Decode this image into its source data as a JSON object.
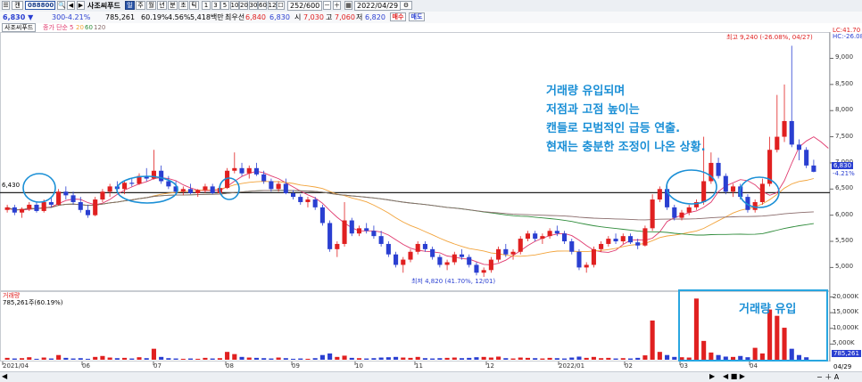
{
  "toolbar": {
    "mode_label": "캔",
    "stock_code": "088800",
    "stock_name": "사조씨푸드",
    "period_buttons": [
      "일",
      "주",
      "월",
      "년",
      "분",
      "초",
      "틱"
    ],
    "interval_buttons": [
      "1",
      "3",
      "5",
      "10",
      "20",
      "30",
      "60",
      "120"
    ],
    "count": "252",
    "count_total": "600",
    "date": "2022/04/29",
    "buy_label": "매수",
    "sell_label": "매도"
  },
  "quote": {
    "price": "6,830 ▼",
    "change": "300",
    "change_pct": "-4.21%",
    "volume": "785,261",
    "vol_ratio": "60.19%",
    "turnover_ratio": "4.56%",
    "amount": "5,418백만",
    "priority_label": "최우선",
    "bid1": "6,840",
    "ask1": "6,830",
    "open_label": "시",
    "open": "7,030",
    "high_label": "고",
    "high": "7,060",
    "low_label": "저",
    "low": "6,820"
  },
  "legend": {
    "name": "사조씨푸드",
    "ma_label": "종가 단순",
    "ma_periods": [
      "5",
      "20",
      "60",
      "120"
    ],
    "ma_colors": [
      "#e0396e",
      "#f2a33a",
      "#2e8b3a",
      "#8a6b6b"
    ]
  },
  "price_pane": {
    "ref_line_label": "6,430",
    "ref_value": 6430,
    "lc_label": "LC:41.70",
    "hc_label": "HC:-26.08",
    "last_label": "6,830",
    "last_pct": "-4.21%",
    "high_note": "최고 9,240 (-26.08%, 04/27)",
    "low_note": "최저 4,820 (41.70%, 12/01)",
    "annotation_lines": [
      "거래량 유입되며",
      "저점과 고점 높이는",
      "캔들로 모범적인 급등 연출.",
      "현재는 충분한 조정이 나온 상황."
    ]
  },
  "volume_pane": {
    "title": "거래량",
    "value_label": "785,261주(60.19%)",
    "last_label": "785,261",
    "last_date_label": "04/29",
    "annotation": "거래량 유입"
  },
  "axis": {
    "price_ticks": [
      "9,000",
      "8,500",
      "8,000",
      "7,500",
      "7,000",
      "6,500",
      "6,000",
      "5,500",
      "5,000"
    ],
    "volume_ticks": [
      "20,000K",
      "15,000K",
      "10,000K",
      "5,000K"
    ],
    "date_labels": [
      "2021/04",
      "06",
      "07",
      "08",
      "09",
      "10",
      "11",
      "12",
      "2022/01",
      "02",
      "03",
      "04"
    ]
  },
  "colors": {
    "up": "#e02020",
    "down": "#2a3fd1",
    "accent": "#1a8fd6"
  },
  "chart_data": {
    "type": "candlestick",
    "price_range": [
      4700,
      9400
    ],
    "volume_range": [
      0,
      21000
    ],
    "volume_unit": "K",
    "dates": [
      "2021/04",
      "06",
      "07",
      "08",
      "09",
      "10",
      "11",
      "12",
      "2022/01",
      "02",
      "03",
      "04"
    ],
    "candles": [
      [
        6100,
        6200,
        6050,
        6150
      ],
      [
        6150,
        6200,
        6000,
        6050
      ],
      [
        6050,
        6150,
        5950,
        6120
      ],
      [
        6120,
        6250,
        6080,
        6200
      ],
      [
        6200,
        6250,
        6050,
        6080
      ],
      [
        6080,
        6300,
        6050,
        6250
      ],
      [
        6250,
        6350,
        6150,
        6200
      ],
      [
        6200,
        6500,
        6180,
        6450
      ],
      [
        6450,
        6550,
        6300,
        6380
      ],
      [
        6380,
        6450,
        6200,
        6250
      ],
      [
        6250,
        6350,
        6050,
        6100
      ],
      [
        6100,
        6200,
        5950,
        6000
      ],
      [
        6000,
        6350,
        5980,
        6300
      ],
      [
        6300,
        6500,
        6250,
        6450
      ],
      [
        6450,
        6600,
        6350,
        6550
      ],
      [
        6550,
        6650,
        6450,
        6500
      ],
      [
        6500,
        6650,
        6400,
        6620
      ],
      [
        6620,
        6700,
        6550,
        6600
      ],
      [
        6600,
        6800,
        6580,
        6750
      ],
      [
        6750,
        6900,
        6650,
        6700
      ],
      [
        6700,
        7250,
        6680,
        6850
      ],
      [
        6850,
        6950,
        6600,
        6650
      ],
      [
        6650,
        6750,
        6500,
        6550
      ],
      [
        6550,
        6650,
        6400,
        6450
      ],
      [
        6450,
        6550,
        6380,
        6500
      ],
      [
        6500,
        6600,
        6400,
        6420
      ],
      [
        6420,
        6500,
        6350,
        6480
      ],
      [
        6480,
        6600,
        6420,
        6550
      ],
      [
        6550,
        6600,
        6400,
        6420
      ],
      [
        6420,
        6550,
        6400,
        6520
      ],
      [
        6520,
        6900,
        6500,
        6850
      ],
      [
        6850,
        7200,
        6800,
        6900
      ],
      [
        6900,
        7000,
        6750,
        6800
      ],
      [
        6800,
        6950,
        6700,
        6900
      ],
      [
        6900,
        7000,
        6750,
        6780
      ],
      [
        6780,
        6850,
        6600,
        6650
      ],
      [
        6650,
        6700,
        6450,
        6500
      ],
      [
        6500,
        6650,
        6450,
        6600
      ],
      [
        6600,
        6700,
        6400,
        6420
      ],
      [
        6420,
        6480,
        6300,
        6350
      ],
      [
        6350,
        6400,
        6200,
        6250
      ],
      [
        6250,
        6350,
        6150,
        6300
      ],
      [
        6300,
        6350,
        6100,
        6150
      ],
      [
        6150,
        6200,
        5800,
        5850
      ],
      [
        5850,
        5900,
        5300,
        5350
      ],
      [
        5350,
        5500,
        5200,
        5450
      ],
      [
        5450,
        6250,
        5400,
        5900
      ],
      [
        5900,
        5950,
        5600,
        5650
      ],
      [
        5650,
        5800,
        5600,
        5750
      ],
      [
        5750,
        5850,
        5650,
        5700
      ],
      [
        5700,
        5800,
        5550,
        5600
      ],
      [
        5600,
        5700,
        5400,
        5450
      ],
      [
        5450,
        5500,
        5200,
        5250
      ],
      [
        5250,
        5300,
        5000,
        5050
      ],
      [
        5050,
        5200,
        4900,
        5150
      ],
      [
        5150,
        5350,
        5100,
        5300
      ],
      [
        5300,
        5500,
        5250,
        5450
      ],
      [
        5450,
        5500,
        5300,
        5350
      ],
      [
        5350,
        5400,
        5150,
        5200
      ],
      [
        5200,
        5250,
        5000,
        5050
      ],
      [
        5050,
        5150,
        4950,
        5100
      ],
      [
        5100,
        5300,
        5050,
        5250
      ],
      [
        5250,
        5350,
        5150,
        5200
      ],
      [
        5200,
        5250,
        5000,
        5050
      ],
      [
        5050,
        5100,
        4850,
        4900
      ],
      [
        4900,
        5000,
        4820,
        4950
      ],
      [
        4950,
        5200,
        4900,
        5150
      ],
      [
        5150,
        5400,
        5100,
        5350
      ],
      [
        5350,
        5450,
        5200,
        5250
      ],
      [
        5250,
        5350,
        5150,
        5300
      ],
      [
        5300,
        5600,
        5250,
        5550
      ],
      [
        5550,
        5700,
        5500,
        5650
      ],
      [
        5650,
        5700,
        5500,
        5550
      ],
      [
        5550,
        5650,
        5450,
        5600
      ],
      [
        5600,
        5750,
        5550,
        5700
      ],
      [
        5700,
        5800,
        5600,
        5650
      ],
      [
        5650,
        5700,
        5450,
        5500
      ],
      [
        5500,
        5550,
        5250,
        5300
      ],
      [
        5300,
        5350,
        4950,
        5000
      ],
      [
        5000,
        5100,
        4900,
        5050
      ],
      [
        5050,
        5400,
        5000,
        5350
      ],
      [
        5350,
        5500,
        5300,
        5450
      ],
      [
        5450,
        5600,
        5400,
        5550
      ],
      [
        5550,
        5650,
        5450,
        5500
      ],
      [
        5500,
        5650,
        5450,
        5600
      ],
      [
        5600,
        5650,
        5450,
        5480
      ],
      [
        5480,
        5550,
        5350,
        5420
      ],
      [
        5420,
        5800,
        5400,
        5750
      ],
      [
        5750,
        6400,
        5700,
        6300
      ],
      [
        6300,
        6550,
        6250,
        6500
      ],
      [
        6500,
        6600,
        6100,
        6150
      ],
      [
        6150,
        6200,
        5900,
        5950
      ],
      [
        5950,
        6100,
        5900,
        6050
      ],
      [
        6050,
        6200,
        6000,
        6150
      ],
      [
        6150,
        6300,
        6100,
        6250
      ],
      [
        6250,
        7500,
        6200,
        6650
      ],
      [
        6650,
        7200,
        6600,
        7000
      ],
      [
        7000,
        7100,
        6700,
        6750
      ],
      [
        6750,
        6800,
        6400,
        6450
      ],
      [
        6450,
        6600,
        6350,
        6550
      ],
      [
        6550,
        6600,
        6300,
        6350
      ],
      [
        6350,
        6400,
        6050,
        6100
      ],
      [
        6100,
        6300,
        6050,
        6250
      ],
      [
        6250,
        6700,
        6200,
        6600
      ],
      [
        6600,
        7500,
        6550,
        7250
      ],
      [
        7250,
        8300,
        7200,
        7500
      ],
      [
        7500,
        8500,
        7400,
        7800
      ],
      [
        7800,
        9240,
        7300,
        7350
      ],
      [
        7350,
        7450,
        7050,
        7250
      ],
      [
        7250,
        7300,
        6900,
        6950
      ],
      [
        6950,
        7060,
        6820,
        6830
      ]
    ],
    "volumes": [
      600,
      400,
      500,
      800,
      300,
      700,
      400,
      1500,
      600,
      400,
      500,
      300,
      900,
      1200,
      700,
      500,
      600,
      400,
      800,
      500,
      3500,
      900,
      500,
      400,
      300,
      400,
      300,
      600,
      400,
      500,
      2500,
      1800,
      900,
      700,
      600,
      500,
      400,
      700,
      500,
      300,
      400,
      300,
      500,
      1500,
      2000,
      900,
      1300,
      600,
      500,
      400,
      500,
      700,
      800,
      900,
      700,
      600,
      900,
      500,
      400,
      500,
      600,
      700,
      500,
      600,
      800,
      900,
      700,
      1000,
      500,
      400,
      700,
      600,
      500,
      400,
      600,
      500,
      400,
      700,
      1000,
      600,
      900,
      500,
      600,
      400,
      500,
      400,
      600,
      1400,
      12500,
      2500,
      1500,
      900,
      800,
      700,
      19500,
      6000,
      2300,
      1500,
      1000,
      900,
      1200,
      800,
      3800,
      2000,
      16000,
      14000,
      10200,
      3500,
      1500,
      785
    ],
    "ma5": [
      6120,
      6110,
      6100,
      6110,
      6130,
      6140,
      6160,
      6220,
      6280,
      6310,
      6300,
      6240,
      6200,
      6230,
      6300,
      6400,
      6480,
      6540,
      6600,
      6640,
      6700,
      6720,
      6700,
      6660,
      6580,
      6520,
      6480,
      6470,
      6470,
      6470,
      6550,
      6650,
      6740,
      6800,
      6840,
      6810,
      6750,
      6700,
      6620,
      6540,
      6460,
      6390,
      6330,
      6230,
      6090,
      5960,
      5850,
      5760,
      5700,
      5700,
      5700,
      5680,
      5620,
      5530,
      5440,
      5370,
      5330,
      5310,
      5300,
      5280,
      5220,
      5200,
      5170,
      5160,
      5110,
      5060,
      5050,
      5080,
      5140,
      5230,
      5320,
      5420,
      5500,
      5560,
      5610,
      5640,
      5650,
      5610,
      5520,
      5420,
      5330,
      5300,
      5290,
      5330,
      5440,
      5520,
      5530,
      5520,
      5560,
      5680,
      5880,
      5950,
      6000,
      6050,
      6080,
      6150,
      6250,
      6450,
      6560,
      6620,
      6680,
      6660,
      6580,
      6450,
      6380,
      6430,
      6660,
      6990,
      7300,
      7420,
      7500,
      7400,
      7280
    ]
  }
}
